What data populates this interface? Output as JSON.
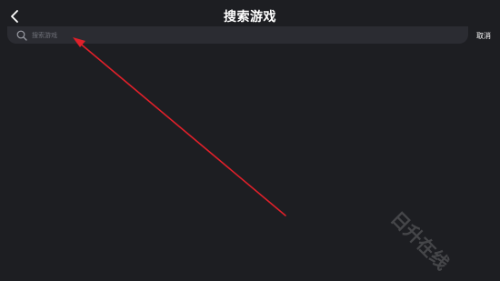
{
  "header": {
    "title": "搜索游戏",
    "back_icon": "chevron-left-icon"
  },
  "search": {
    "placeholder": "搜索游戏",
    "icon": "search-icon",
    "cancel_label": "取消"
  },
  "annotation": {
    "arrow_color": "#e0202a"
  },
  "watermark": {
    "text": "日升在线"
  },
  "colors": {
    "background": "#1d1e22",
    "search_bar": "#2b2c32"
  }
}
